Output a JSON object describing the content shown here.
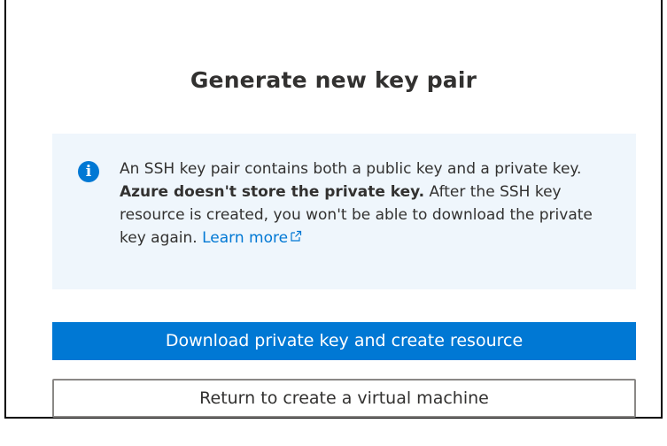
{
  "dialog": {
    "title": "Generate new key pair"
  },
  "info": {
    "icon": "info-icon",
    "text_part1": "An SSH key pair contains both a public key and a private key. ",
    "text_bold": "Azure doesn't store the private key.",
    "text_part2": " After the SSH key resource is created, you won't be able to download the private key again. ",
    "learn_more_label": "Learn more"
  },
  "buttons": {
    "primary_label": "Download private key and create resource",
    "secondary_label": "Return to create a virtual machine"
  },
  "colors": {
    "accent": "#0078d4",
    "info_background": "#eff6fc",
    "text": "#323130"
  }
}
